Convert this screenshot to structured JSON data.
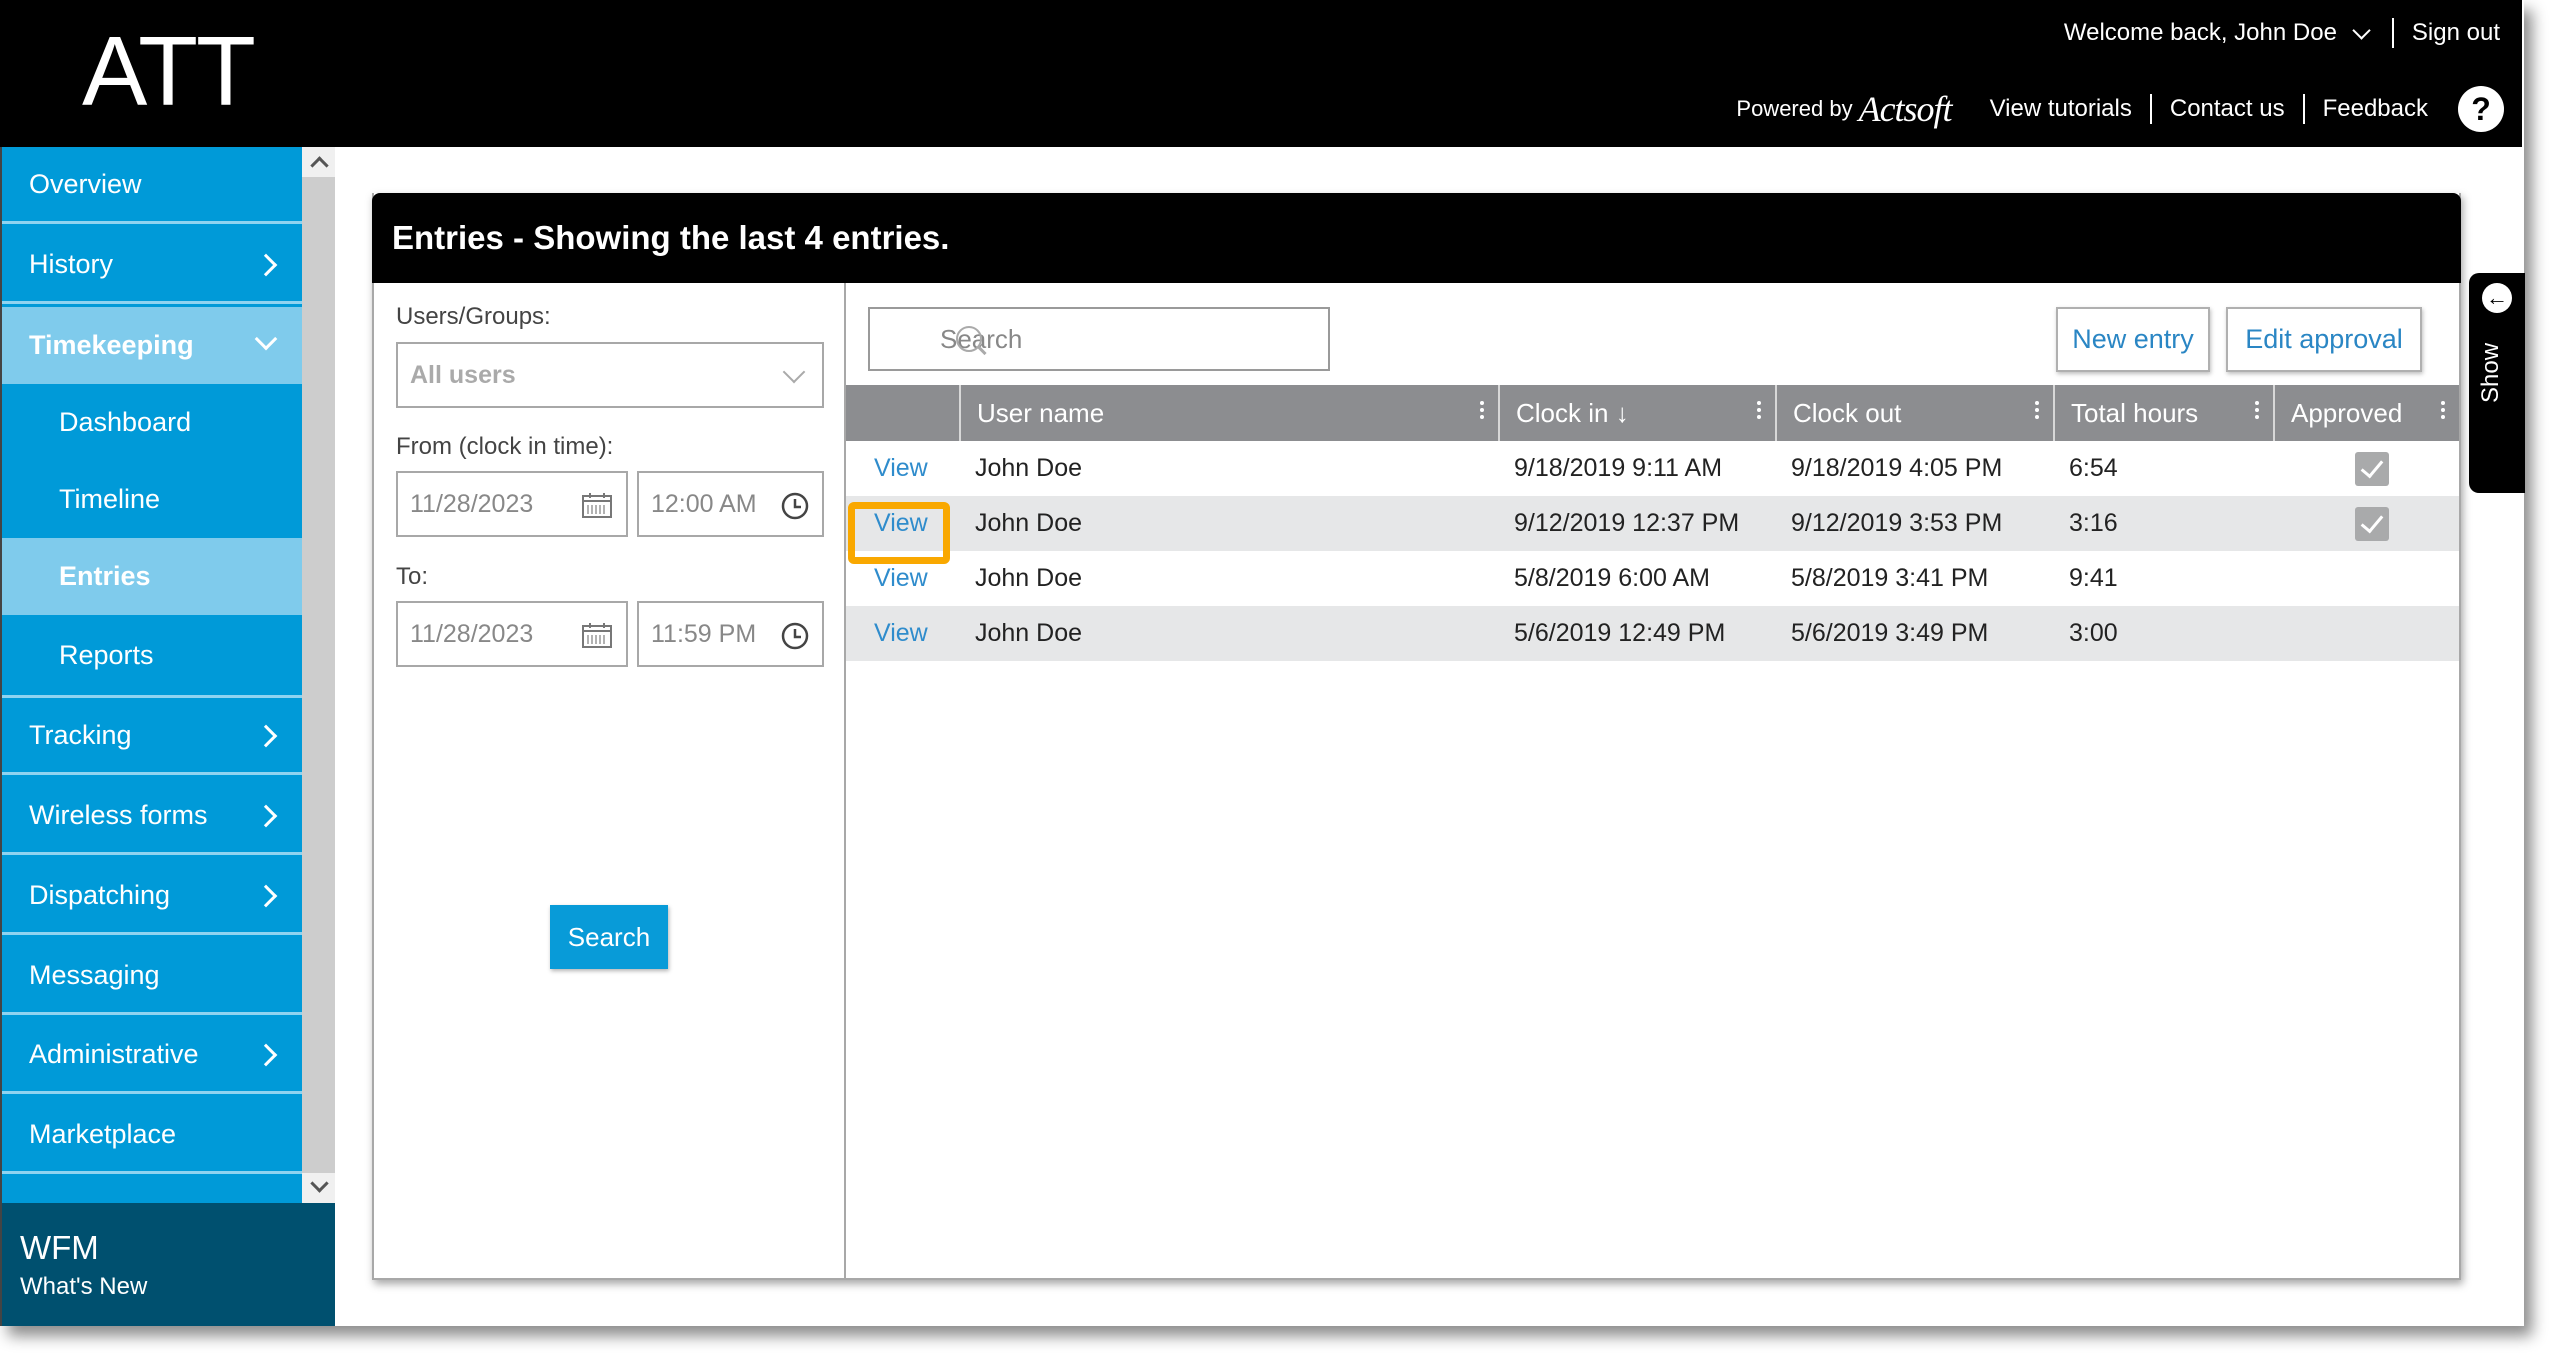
{
  "header": {
    "logo": "ATT",
    "welcome": "Welcome back, John Doe",
    "sign_out": "Sign out",
    "powered_by": "Powered by",
    "brand": "Actsoft",
    "links": [
      "View tutorials",
      "Contact us",
      "Feedback"
    ],
    "help_icon": "?"
  },
  "sidebar": {
    "items": [
      {
        "label": "Overview",
        "chevron": false
      },
      {
        "label": "History",
        "chevron": true
      },
      {
        "label": "Timekeeping",
        "chevron": true,
        "expanded": true,
        "active": true
      },
      {
        "label": "Dashboard",
        "sub": true
      },
      {
        "label": "Timeline",
        "sub": true
      },
      {
        "label": "Entries",
        "sub": true,
        "active": true
      },
      {
        "label": "Reports",
        "sub": true
      },
      {
        "label": "Tracking",
        "chevron": true
      },
      {
        "label": "Wireless forms",
        "chevron": true
      },
      {
        "label": "Dispatching",
        "chevron": true
      },
      {
        "label": "Messaging",
        "chevron": false
      },
      {
        "label": "Administrative",
        "chevron": true
      },
      {
        "label": "Marketplace",
        "chevron": false
      }
    ],
    "footer": {
      "title": "WFM",
      "subtitle": "What's New"
    }
  },
  "panel": {
    "title": "Entries - Showing the last 4 entries.",
    "filters": {
      "users_label": "Users/Groups:",
      "users_value": "All users",
      "from_label": "From (clock in time):",
      "from_date": "11/28/2023",
      "from_time": "12:00 AM",
      "to_label": "To:",
      "to_date": "11/28/2023",
      "to_time": "11:59 PM",
      "search_button": "Search"
    },
    "search_placeholder": "Search",
    "new_entry": "New entry",
    "edit_approval": "Edit approval",
    "columns": [
      "",
      "User name",
      "Clock in ↓",
      "Clock out",
      "Total hours",
      "Approved"
    ],
    "rows": [
      {
        "action": "View",
        "user": "John Doe",
        "clock_in": "9/18/2019 9:11 AM",
        "clock_out": "9/18/2019 4:05 PM",
        "total": "6:54",
        "approved": true
      },
      {
        "action": "View",
        "user": "John Doe",
        "clock_in": "9/12/2019 12:37 PM",
        "clock_out": "9/12/2019 3:53 PM",
        "total": "3:16",
        "approved": true,
        "highlighted": true
      },
      {
        "action": "View",
        "user": "John Doe",
        "clock_in": "5/8/2019 6:00 AM",
        "clock_out": "5/8/2019 3:41 PM",
        "total": "9:41",
        "approved": false
      },
      {
        "action": "View",
        "user": "John Doe",
        "clock_in": "5/6/2019 12:49 PM",
        "clock_out": "5/6/2019 3:49 PM",
        "total": "3:00",
        "approved": false
      }
    ]
  },
  "show_tab": {
    "label": "Show"
  },
  "colors": {
    "sidebar": "#009ad8",
    "sidebar_active": "#7fcbec",
    "footer": "#00506f",
    "highlight": "#f9a800",
    "link": "#2f8ccc"
  }
}
